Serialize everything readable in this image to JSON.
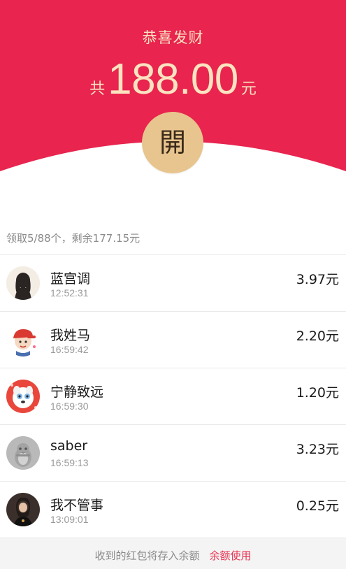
{
  "header": {
    "greeting": "恭喜发财",
    "amount_prefix": "共",
    "amount_value": "188.00",
    "amount_suffix": "元",
    "open_button_label": "開",
    "brand_color": "#e8244f",
    "accent_color": "#e8c58e"
  },
  "summary": "领取5/88个，剩余177.15元",
  "receivers": [
    {
      "name": "蓝宫调",
      "time": "12:52:31",
      "amount": "3.97元",
      "avatar_icon": "avatar-girl-silhouette-icon"
    },
    {
      "name": "我姓马",
      "time": "16:59:42",
      "amount": "2.20元",
      "avatar_icon": "avatar-cartoon-boy-icon"
    },
    {
      "name": "宁静致远",
      "time": "16:59:30",
      "amount": "1.20元",
      "avatar_icon": "avatar-cartoon-dog-icon"
    },
    {
      "name": "saber",
      "time": "16:59:13",
      "amount": "3.23元",
      "avatar_icon": "avatar-penguin-icon"
    },
    {
      "name": "我不管事",
      "time": "13:09:01",
      "amount": "0.25元",
      "avatar_icon": "avatar-photo-girl-icon"
    }
  ],
  "footer": {
    "note": "收到的红包将存入余额",
    "link_label": "余额使用"
  }
}
